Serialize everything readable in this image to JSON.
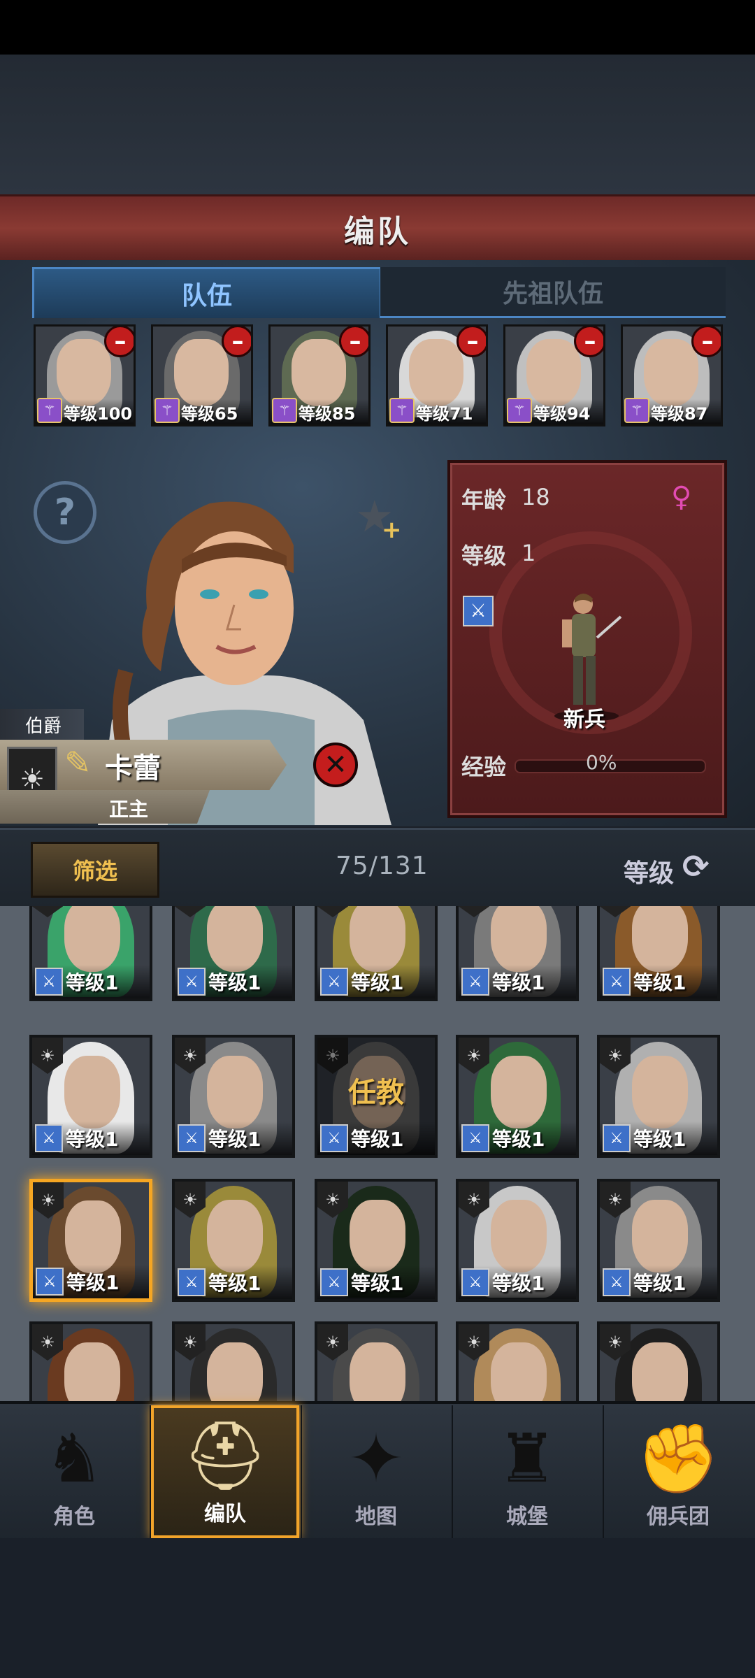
{
  "header": {
    "title": "编队"
  },
  "tabs": [
    {
      "label": "队伍",
      "active": true
    },
    {
      "label": "先祖队伍",
      "active": false
    }
  ],
  "party": [
    {
      "level": "等级100",
      "hair": "#9a9a9a"
    },
    {
      "level": "等级65",
      "hair": "#6a6a6a"
    },
    {
      "level": "等级85",
      "hair": "#5e6a52"
    },
    {
      "level": "等级71",
      "hair": "#d8d8d8"
    },
    {
      "level": "等级94",
      "hair": "#c0c0c0"
    },
    {
      "level": "等级87",
      "hair": "#bdbdbd"
    }
  ],
  "hero": {
    "rank": "伯爵",
    "name": "卡蕾",
    "role": "正主",
    "edit_icon": "pen-icon",
    "help_icon": "question-icon"
  },
  "stats": {
    "age_label": "年龄",
    "age": "18",
    "level_label": "等级",
    "level": "1",
    "class_name": "新兵",
    "exp_label": "经验",
    "exp": "0%",
    "gender_icon": "female-icon"
  },
  "filter": {
    "button": "筛选",
    "count": "75/131",
    "sort_label": "等级"
  },
  "roster": [
    {
      "level": "等级1",
      "hair": "#3aa36a"
    },
    {
      "level": "等级1",
      "hair": "#2e6a4a"
    },
    {
      "level": "等级1",
      "hair": "#9a8a3a"
    },
    {
      "level": "等级1",
      "hair": "#7a7a7a"
    },
    {
      "level": "等级1",
      "hair": "#8a5a2a"
    },
    {
      "level": "等级1",
      "hair": "#e8e8e8"
    },
    {
      "level": "等级1",
      "hair": "#8a8a8a"
    },
    {
      "level": "等级1",
      "hair": "#6a6a6a",
      "assigned": "任教"
    },
    {
      "level": "等级1",
      "hair": "#2e6a3a"
    },
    {
      "level": "等级1",
      "hair": "#b0b0b0"
    },
    {
      "level": "等级1",
      "hair": "#6a4a2e",
      "selected": true
    },
    {
      "level": "等级1",
      "hair": "#9a8a3a"
    },
    {
      "level": "等级1",
      "hair": "#1a2a1a"
    },
    {
      "level": "等级1",
      "hair": "#c8c8c8"
    },
    {
      "level": "等级1",
      "hair": "#8a8a8a"
    },
    {
      "level": "",
      "hair": "#6a3a20"
    },
    {
      "level": "",
      "hair": "#2a2a2a"
    },
    {
      "level": "",
      "hair": "#4a4a4a"
    },
    {
      "level": "",
      "hair": "#b08a5a"
    },
    {
      "level": "",
      "hair": "#1e1e1e"
    }
  ],
  "nav": [
    {
      "label": "角色",
      "icon": "knight-icon",
      "active": false
    },
    {
      "label": "编队",
      "icon": "helmet-icon",
      "active": true
    },
    {
      "label": "地图",
      "icon": "compass-icon",
      "active": false
    },
    {
      "label": "城堡",
      "icon": "castle-icon",
      "active": false
    },
    {
      "label": "佣兵团",
      "icon": "fist-icon",
      "active": false
    }
  ],
  "colors": {
    "accent": "#f2a42a",
    "tab_active": "#8fc4ff",
    "remove": "#c21d1d",
    "class_icon": "#3e70c8"
  }
}
